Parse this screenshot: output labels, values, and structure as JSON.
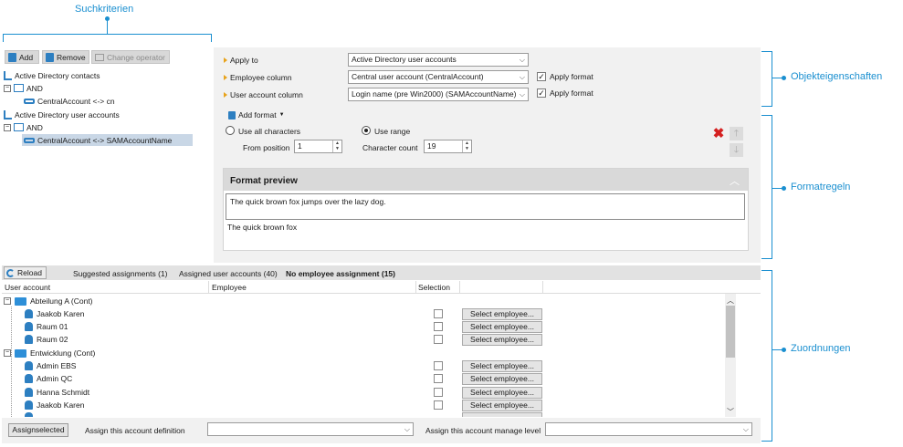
{
  "callouts": {
    "search": "Suchkriterien",
    "object_props": "Objekteigenschaften",
    "format_rules": "Formatregeln",
    "assignments": "Zuordnungen"
  },
  "toolbar": {
    "add": "Add",
    "remove": "Remove",
    "change_operator": "Change operator"
  },
  "tree": {
    "items": [
      {
        "label": "Active Directory contacts"
      },
      {
        "label": "AND"
      },
      {
        "label": "CentralAccount <-> cn"
      },
      {
        "label": "Active Directory user accounts"
      },
      {
        "label": "AND"
      },
      {
        "label": "CentralAccount <-> SAMAccountName"
      }
    ]
  },
  "props": {
    "apply_to_label": "Apply to",
    "apply_to_value": "Active Directory user accounts",
    "employee_col_label": "Employee column",
    "employee_col_value": "Central user account (CentralAccount)",
    "user_col_label": "User account column",
    "user_col_value": "Login name (pre Win2000) (SAMAccountName)",
    "apply_format": "Apply format"
  },
  "format": {
    "add_format": "Add format",
    "use_all": "Use all characters",
    "use_range": "Use range",
    "from_position_label": "From position",
    "from_position_value": "1",
    "char_count_label": "Character count",
    "char_count_value": "19",
    "preview_title": "Format preview",
    "preview_input": "The quick brown fox jumps over the lazy dog.",
    "preview_output": "The quick brown fox"
  },
  "assign": {
    "reload": "Reload",
    "tabs": [
      "Suggested assignments (1)",
      "Assigned user accounts (40)",
      "No employee assignment (15)"
    ],
    "columns": [
      "User account",
      "Employee",
      "Selection"
    ],
    "groups": [
      {
        "label": "Abteilung A (Cont)"
      },
      {
        "label": "Entwicklung (Cont)"
      }
    ],
    "rows": [
      {
        "label": "Jaakob Karen"
      },
      {
        "label": "Raum 01"
      },
      {
        "label": "Raum 02"
      },
      {
        "label": "Admin EBS"
      },
      {
        "label": "Admin QC"
      },
      {
        "label": "Hanna Schmidt"
      },
      {
        "label": "Jaakob Karen"
      }
    ],
    "select_btn": "Select employee...",
    "assign_selected": "Assignselected",
    "assign_def_label": "Assign this account definition",
    "assign_level_label": "Assign this account manage level"
  },
  "colors": {
    "accent": "#1a8fd0",
    "selection": "#c9d7e6",
    "delete_red": "#d42020"
  },
  "icons": [
    "add-icon",
    "remove-icon",
    "operator-icon",
    "database-icon",
    "and-icon",
    "link-icon",
    "reload-icon",
    "folder-icon",
    "person-icon",
    "delete-icon",
    "arrow-up-icon",
    "arrow-down-icon"
  ]
}
